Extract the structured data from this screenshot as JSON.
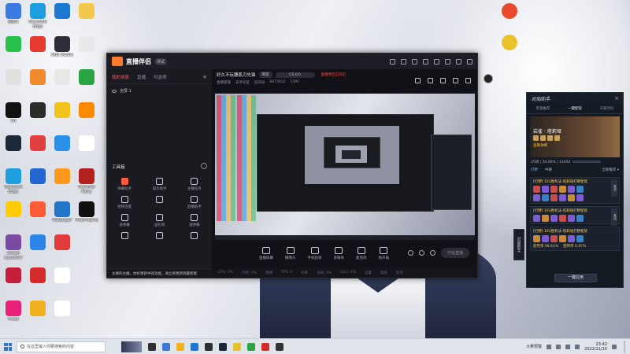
{
  "desktop": {
    "icons_left": [
      {
        "label": "图标1",
        "color": "#3a7be0"
      },
      {
        "label": "",
        "color": "#27c24c"
      },
      {
        "label": "",
        "color": "#e0e0e0"
      },
      {
        "label": "VR",
        "color": "#111111"
      },
      {
        "label": "",
        "color": "#1b2838"
      },
      {
        "label": "Microsoft Edge",
        "color": "#1f9fe0"
      },
      {
        "label": "",
        "color": "#ffcc00"
      },
      {
        "label": "Steam Launcher",
        "color": "#7a4ba0"
      },
      {
        "label": "",
        "color": "#c4203c"
      },
      {
        "label": "Forza",
        "color": "#e8207a"
      },
      {
        "label": "Microsoft Edge",
        "color": "#1f9fe0"
      },
      {
        "label": "",
        "color": "#e63b2e"
      },
      {
        "label": "",
        "color": "#f08a2c"
      },
      {
        "label": "",
        "color": "#2c2c2c"
      },
      {
        "label": "",
        "color": "#e24040"
      },
      {
        "label": "",
        "color": "#2268d0"
      },
      {
        "label": "",
        "color": "#ff5c35"
      },
      {
        "label": "",
        "color": "#2b86e8"
      },
      {
        "label": "",
        "color": "#d62b2b"
      },
      {
        "label": "",
        "color": "#f2b01e"
      },
      {
        "label": "",
        "color": "#1e78d2"
      },
      {
        "label": "OBS Studio",
        "color": "#302e3c"
      },
      {
        "label": "",
        "color": "#e8e8e8"
      },
      {
        "label": "",
        "color": "#f0c419"
      },
      {
        "label": "",
        "color": "#2a92e6"
      },
      {
        "label": "",
        "color": "#ff9a1f"
      },
      {
        "label": "Wallpaper",
        "color": "#2176c9"
      },
      {
        "label": "",
        "color": "#e23b3b"
      },
      {
        "label": "",
        "color": "#ffffff"
      },
      {
        "label": "",
        "color": "#ffffff"
      },
      {
        "label": "",
        "color": "#f2c94c"
      },
      {
        "label": "",
        "color": "#e9e9e9"
      },
      {
        "label": "",
        "color": "#2ca444"
      },
      {
        "label": "",
        "color": "#ff8a00"
      },
      {
        "label": "",
        "color": "#ffffff"
      },
      {
        "label": "Hummer Party",
        "color": "#b3201e"
      },
      {
        "label": "Phasmophobia",
        "color": "#101010"
      }
    ],
    "icons_right": [
      {
        "label": "",
        "color": "#e84a2b"
      },
      {
        "label": "",
        "color": "#e8c32b"
      }
    ]
  },
  "app": {
    "brand": "直播伴侣",
    "version": "测试",
    "left_tabs": [
      "我的场景",
      "直播",
      "可选项"
    ],
    "scene_name": "全屏 1",
    "toolbox_title": "工具箱",
    "tools": [
      {
        "label": "弹幕助手",
        "hot": true
      },
      {
        "label": "观众助手",
        "hot": false
      },
      {
        "label": "主播任务",
        "hot": false
      },
      {
        "label": "视频连麦",
        "hot": false
      },
      {
        "label": "",
        "hot": false
      },
      {
        "label": "直播助手",
        "hot": false
      },
      {
        "label": "送弹幕",
        "hot": false
      },
      {
        "label": "送礼物",
        "hot": false
      },
      {
        "label": "送弹幕",
        "hot": false
      },
      {
        "label": "",
        "hot": false
      },
      {
        "label": "",
        "hot": false
      },
      {
        "label": "",
        "hot": false
      }
    ],
    "notice": "主要的主播，你好更新中的功能，请立即更新到最新版",
    "room": {
      "title": "好久不玩腰肌刃先锋",
      "category_pill": "网游",
      "search_value": "CS:GO",
      "alert": "直播预告已开启",
      "meta1": "直播管理",
      "meta2": "去评论区",
      "meta3": "房间号",
      "room_id": "6073012",
      "likes": "1395"
    },
    "controls": [
      "直播屏幕",
      "摄像头",
      "手机投屏",
      "多媒体",
      "麦克风",
      "扬声器"
    ],
    "start_live": "开始直播",
    "status": [
      "CPU: 0%",
      "内存: 0%",
      "网络",
      "FPS: 0",
      "码率",
      "丢帧: 0%",
      "LOG: 0%",
      "设置",
      "帮助",
      "反馈"
    ]
  },
  "side_tab": "对局助手",
  "helper": {
    "title": "对局助手",
    "tabs": [
      "英雄推荐",
      "一键配装",
      "天赋对比"
    ],
    "hero_name": "岩雀 · 塔莉垭",
    "hero_link": "查看攻略",
    "winrate_line": "25场 | 50.00% | 14492",
    "subtabs": [
      "打野",
      "中路"
    ],
    "sub_right": "全部推荐 ▾",
    "block1_title": "[打野] 101胜利法-塔莉垭打野配装",
    "block2_title": "[打野] 101胜利法-塔莉垭打野配装",
    "block3_title": "[打野] 101胜利法-塔莉垭打野配装",
    "win_left": "使用率 98.61%",
    "win_right": "使用率 0.87%",
    "vtag": "套用",
    "apply_btn": "一键应用"
  },
  "taskbar": {
    "search_placeholder": "在这里输入你要搜索的内容",
    "weather": "大雾预警",
    "time": "23:42",
    "date": "2022/11/10",
    "app_colors": [
      "#2e2e2e",
      "#3c78d8",
      "#f2b01e",
      "#1e78d2",
      "#2e2e2e",
      "#1b2838",
      "#e8c32b",
      "#2ca444",
      "#d62b2b",
      "#333333"
    ]
  }
}
